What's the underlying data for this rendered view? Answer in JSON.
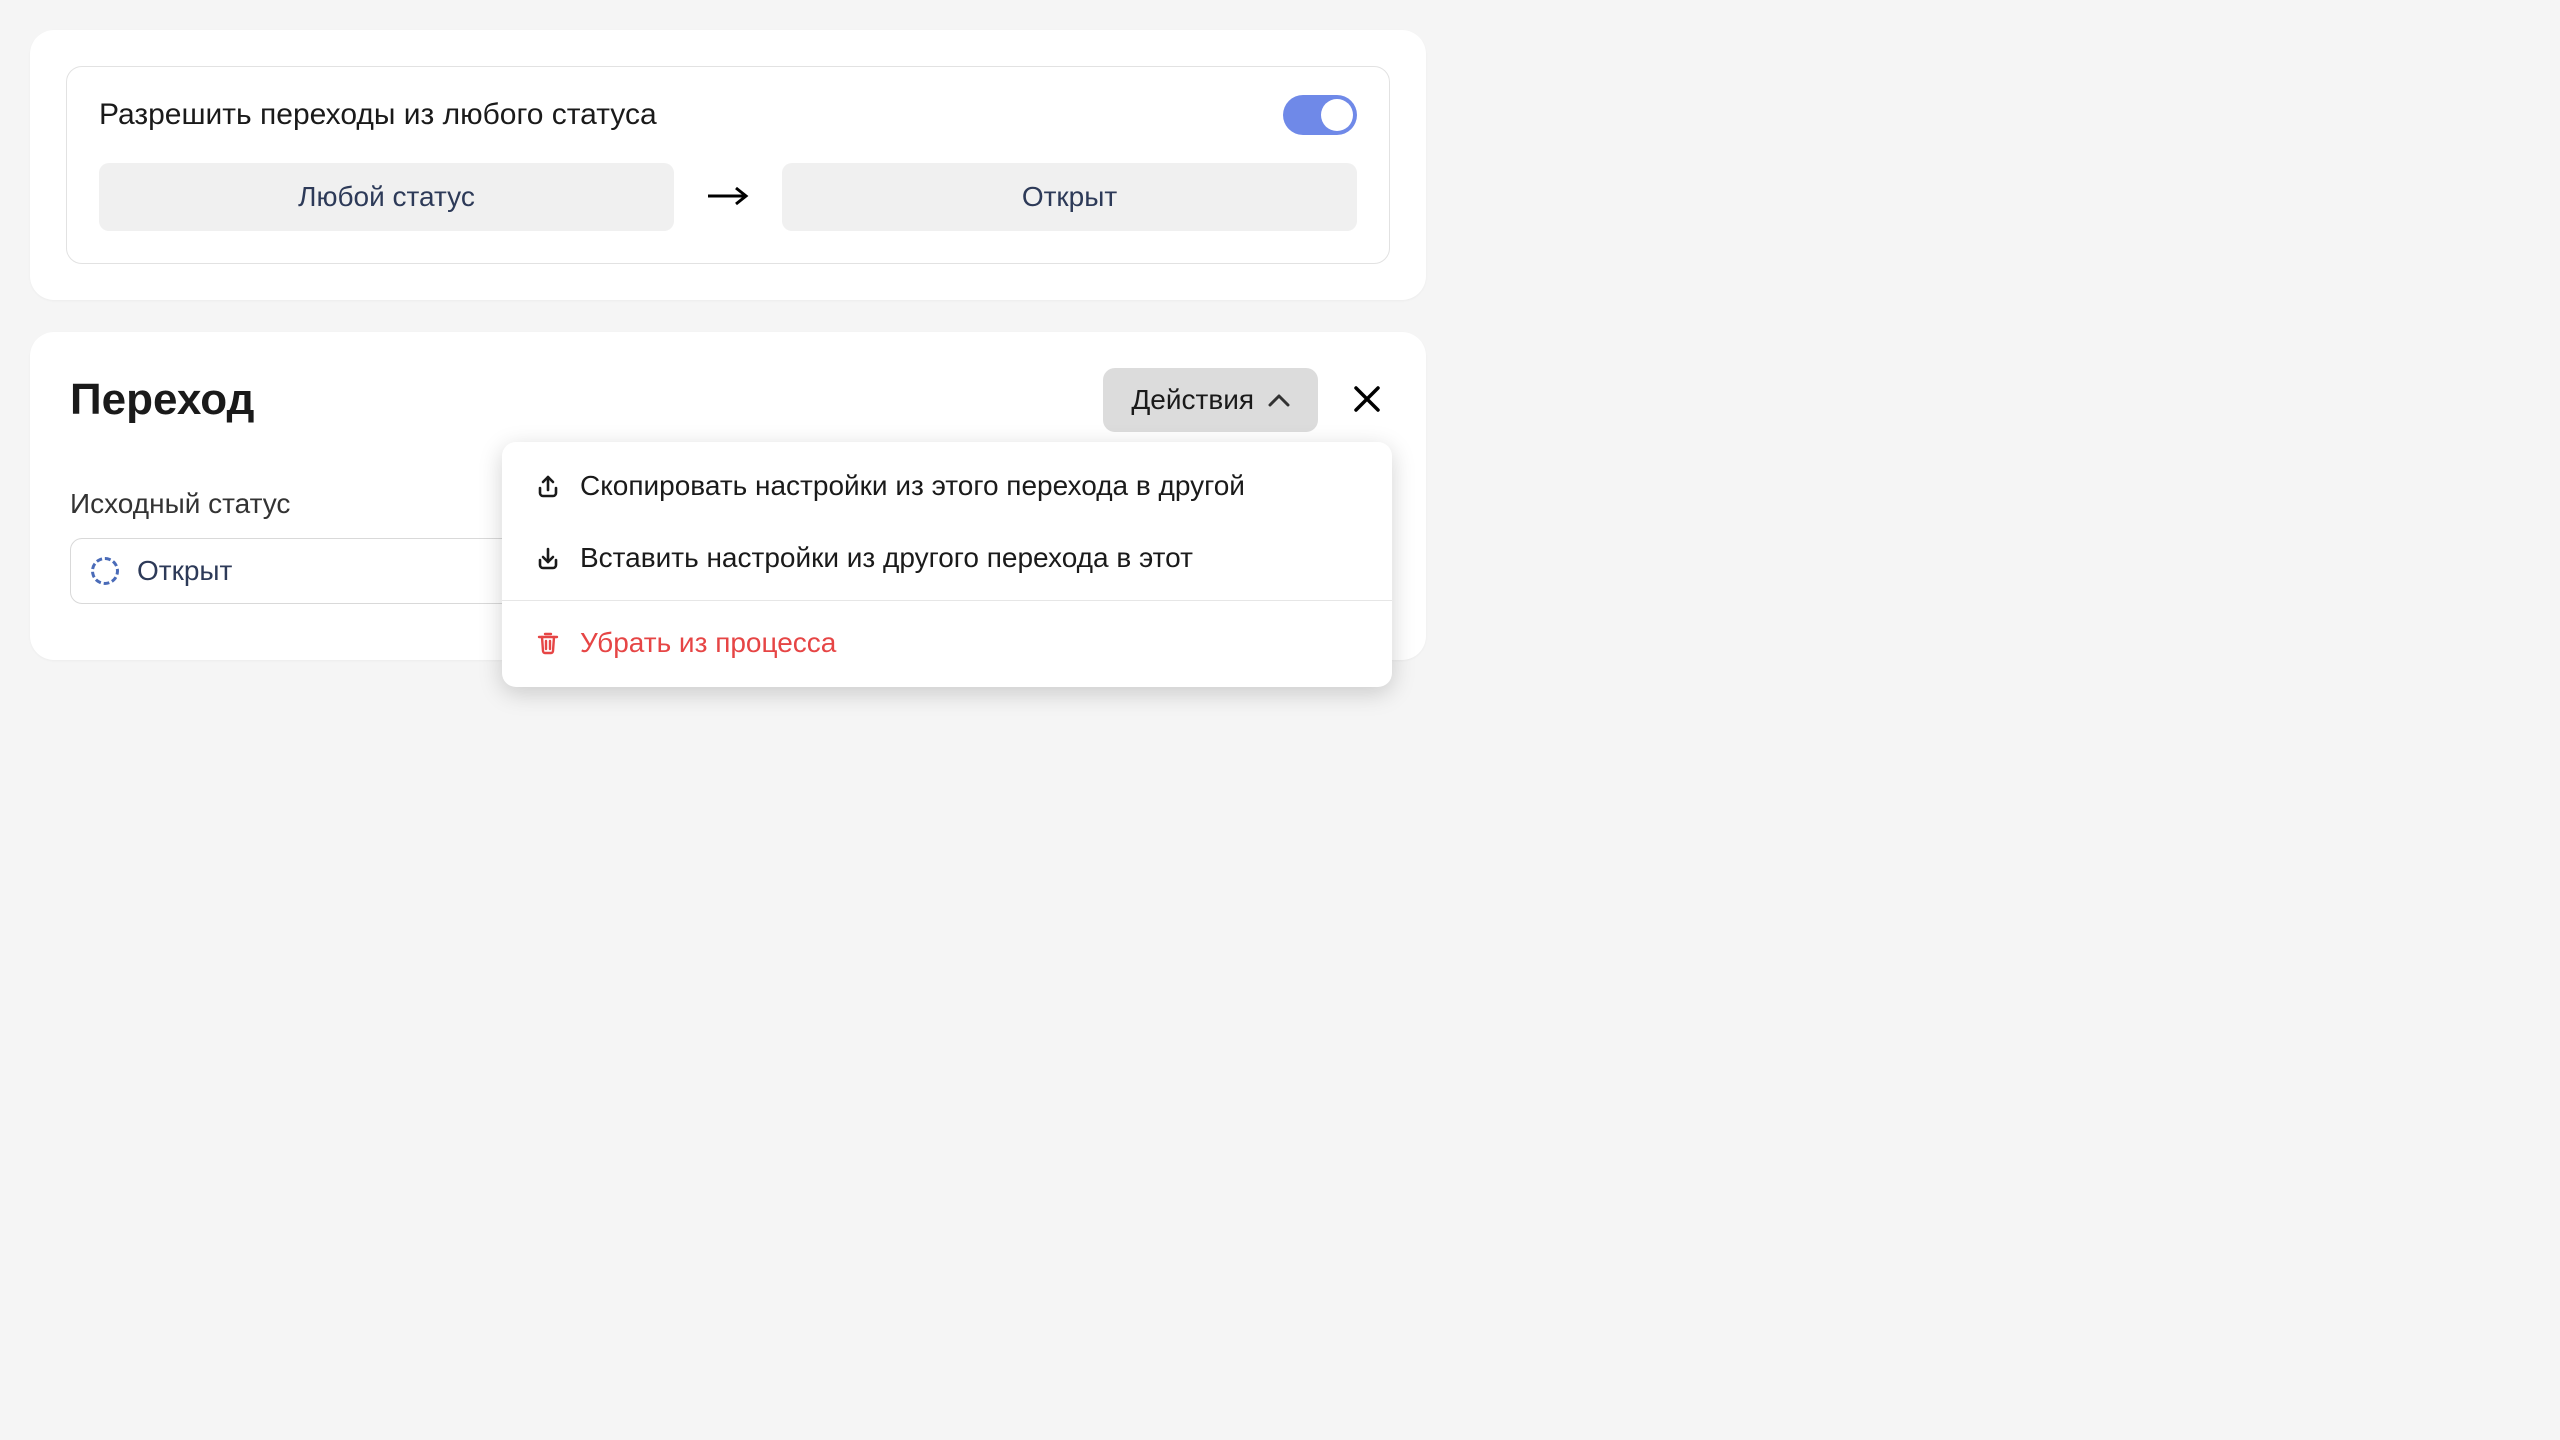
{
  "allow_card": {
    "label": "Разрешить переходы из любого статуса",
    "from_status": "Любой статус",
    "to_status": "Открыт"
  },
  "transition_card": {
    "title": "Переход",
    "actions_label": "Действия",
    "source_status_label": "Исходный статус",
    "source_status_value": "Открыт",
    "menu": {
      "copy_out": "Скопировать настройки из этого перехода в другой",
      "paste_in": "Вставить настройки из другого перехода в этот",
      "remove": "Убрать из процесса"
    }
  }
}
